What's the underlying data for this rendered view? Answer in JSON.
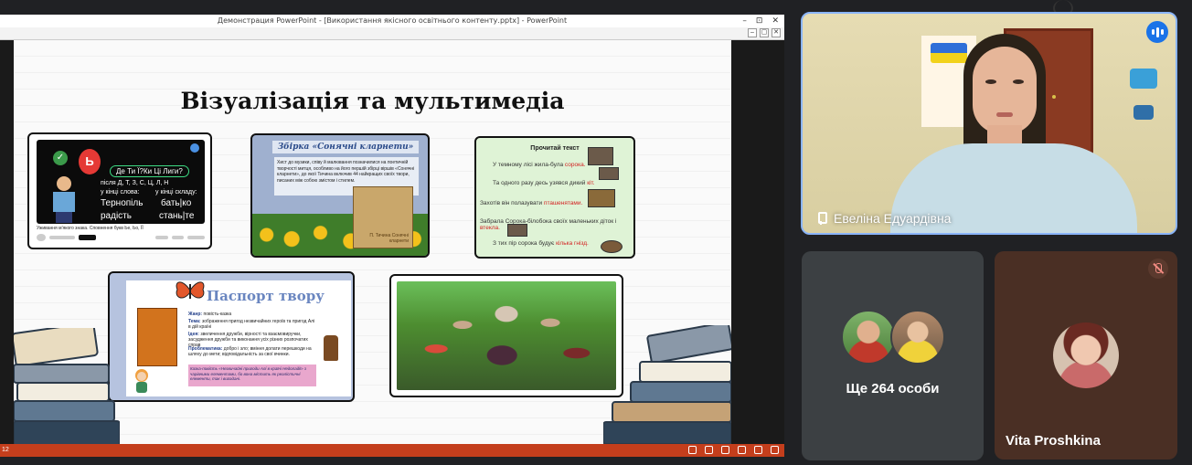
{
  "window": {
    "title": "Демонстрация PowerPoint - [Використання якісного освітнього контенту.pptx] - PowerPoint",
    "controls": [
      "–",
      "⊡",
      "✕"
    ],
    "sub_controls": [
      "–",
      "▢",
      "✕"
    ]
  },
  "slide": {
    "title": "Візуалізація та мультимедіа",
    "video_card": {
      "question": "Де Ти Ї?Ки Ці Лиги?",
      "left_label": "після  Д, Т, З, С, Ц, Л, Н",
      "left_sub": "у кінці слова:",
      "right_sub": "у кінці складу:",
      "word1": "Тернопіль",
      "word2": "радість",
      "word3": "бать|ко",
      "word4": "стань|те",
      "balloon": "Ь",
      "caption": "Уживання м'якого знака. Сповнення букв Ье, Ьо, ЇЇ"
    },
    "book_card": {
      "banner": "Збірка «Сонячні кларнети»",
      "text": "Хист до музики, співу й малювання позначилися на поетичній творчості митця, особливо на його першій збірці віршів «Сонячні кларнети», до якої Тичина включив 44 найкращих своїх твори, писаних між собою змістом і стилем.",
      "book_text": "П. Тичина Сонячні кларнети"
    },
    "text_card": {
      "heading": "Прочитай текст",
      "lines": [
        {
          "text": "У темному лісі жила-була ",
          "red": "сорока."
        },
        {
          "text": "Та одного разу десь узявся дикий ",
          "red": "кіт."
        },
        {
          "text": "Захотів він полазувати ",
          "red": "пташенятами."
        },
        {
          "text": "Забрала Сорока-білобока своїх маленьких діток і ",
          "red": "втекла."
        },
        {
          "text": "З тих пір сорока будує ",
          "red": "кілька гнізд."
        }
      ]
    },
    "passport_card": {
      "title": "Паспорт твору",
      "rows": [
        {
          "label": "Жанр:",
          "value": "повість-казка"
        },
        {
          "label": "Тема:",
          "value": "зображення пригод незвичайних героїв та пригод Алі в дій країні"
        },
        {
          "label": "Ідея:",
          "value": "звеличення дружби, вірності та взаємовиручки, засудження дружби та виконання усіх різних розпочатих справ"
        },
        {
          "label": "Проблематика:",
          "value": "добро і зло; вміння долати перешкоди на шляху до мети; відповідальність за свої вчинки."
        }
      ],
      "note": "Казка-повість «Незвичайні пригоди Алі в країні Недоладії» з чарівними елементами, бо вона містить як реалістичні елементи, так і вигадані."
    }
  },
  "status": {
    "page": "12",
    "icons": [
      "prev-icon",
      "menu-icon",
      "next-icon",
      "normal-view-icon",
      "reading-view-icon",
      "slideshow-icon"
    ]
  },
  "meeting": {
    "main_speaker": "Евеліна Едуардівна",
    "others_label": "Ще 264 особи",
    "participant_name": "Vita Proshkina"
  },
  "colors": {
    "meet_bg": "#202124",
    "active_border": "#8ab4f8",
    "ppt_status": "#c43e1c",
    "speaking_badge": "#1a73e8"
  }
}
